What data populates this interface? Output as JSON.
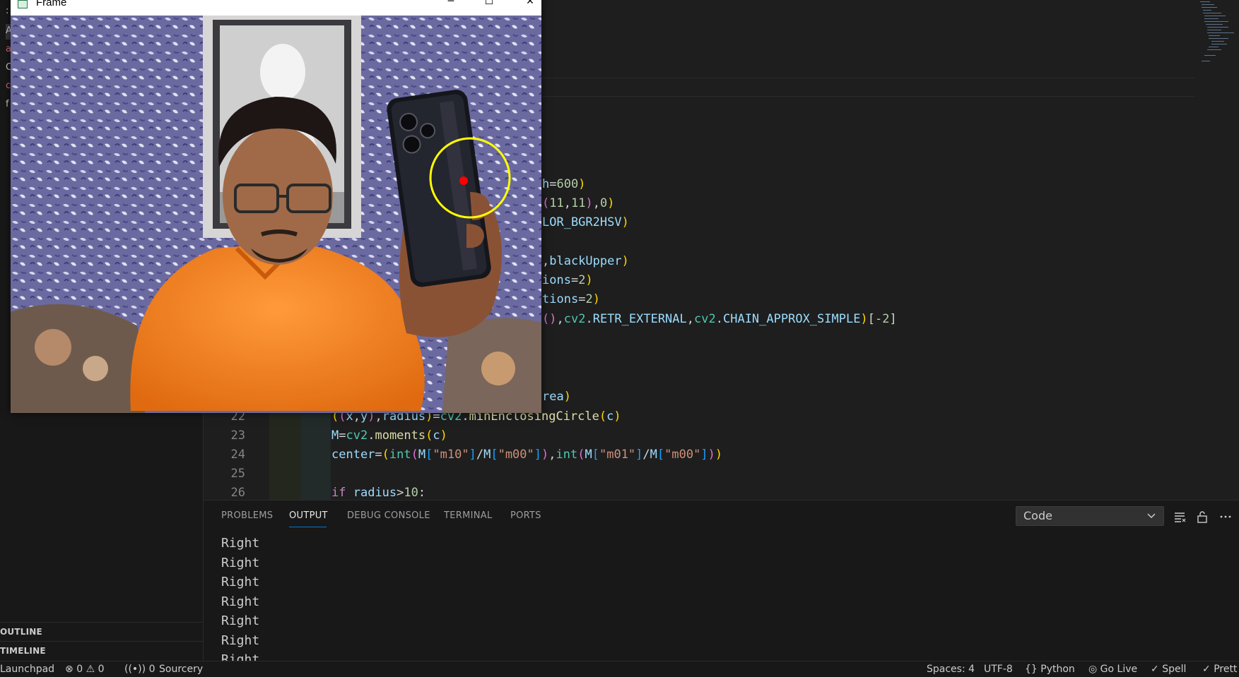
{
  "frame": {
    "title": "Frame",
    "minimize": "─",
    "maximize": "☐",
    "close": "✕"
  },
  "sidebar": {
    "partial_items": [
      ":",
      "A",
      "a",
      "C",
      "c",
      "f"
    ],
    "outline_label": "OUTLINE",
    "timeline_label": "TIMELINE"
  },
  "editor": {
    "line_numbers": [
      "22",
      "23",
      "24",
      "25",
      "26"
    ]
  },
  "panel": {
    "tabs": [
      "PROBLEMS",
      "OUTPUT",
      "DEBUG CONSOLE",
      "TERMINAL",
      "PORTS"
    ],
    "active_tab": "OUTPUT",
    "output_channel": "Code",
    "output_lines": [
      "Right",
      "Right",
      "Right",
      "Right",
      "Right",
      "Right",
      "Right"
    ]
  },
  "statusbar": {
    "launchpad": "Launchpad",
    "errors": "0",
    "warnings": "0",
    "ports": "0",
    "sourcery": "Sourcery",
    "spaces": "Spaces: 4",
    "encoding": "UTF-8",
    "language": "Python",
    "golive": "Go Live",
    "spell": "Spell",
    "prettier": "Prett"
  },
  "colors": {
    "accent": "#0078d4",
    "frame_circle": "#ffff00",
    "frame_center_dot": "#ff0000"
  }
}
